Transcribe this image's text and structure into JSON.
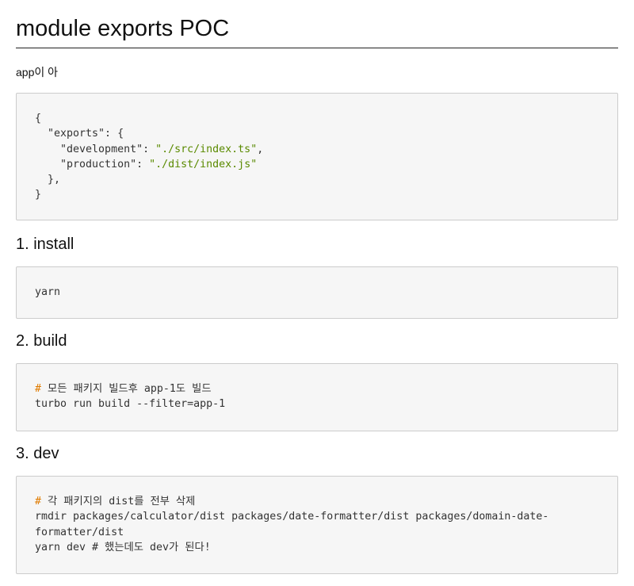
{
  "title": "module exports POC",
  "intro": "app이 아",
  "json_block": {
    "lines": [
      {
        "plain": "{"
      },
      {
        "plain": "  \"exports\": {"
      },
      {
        "key": "    \"development\": ",
        "value": "\"./src/index.ts\"",
        "tail": ","
      },
      {
        "key": "    \"production\": ",
        "value": "\"./dist/index.js\"",
        "tail": ""
      },
      {
        "plain": "  },"
      },
      {
        "plain": "}"
      }
    ]
  },
  "sections": [
    {
      "heading": "1. install",
      "code": {
        "line1": "yarn"
      }
    },
    {
      "heading": "2. build",
      "code": {
        "comment_mark": "#",
        "comment_text": " 모든 패키지 빌드후 app-1도 빌드",
        "line2": "turbo run build --filter=app-1"
      }
    },
    {
      "heading": "3. dev",
      "code": {
        "comment_mark": "#",
        "comment_text": " 각 패키지의 dist를 전부 삭제",
        "line2": "rmdir packages/calculator/dist packages/date-formatter/dist packages/domain-date-",
        "line3": "formatter/dist",
        "line4": "yarn dev # 했는데도 dev가 된다!"
      }
    }
  ],
  "colors": {
    "string": "#5a8a00",
    "comment": "#e07b00",
    "code_background": "#f6f6f6",
    "code_border": "#cccccc"
  }
}
